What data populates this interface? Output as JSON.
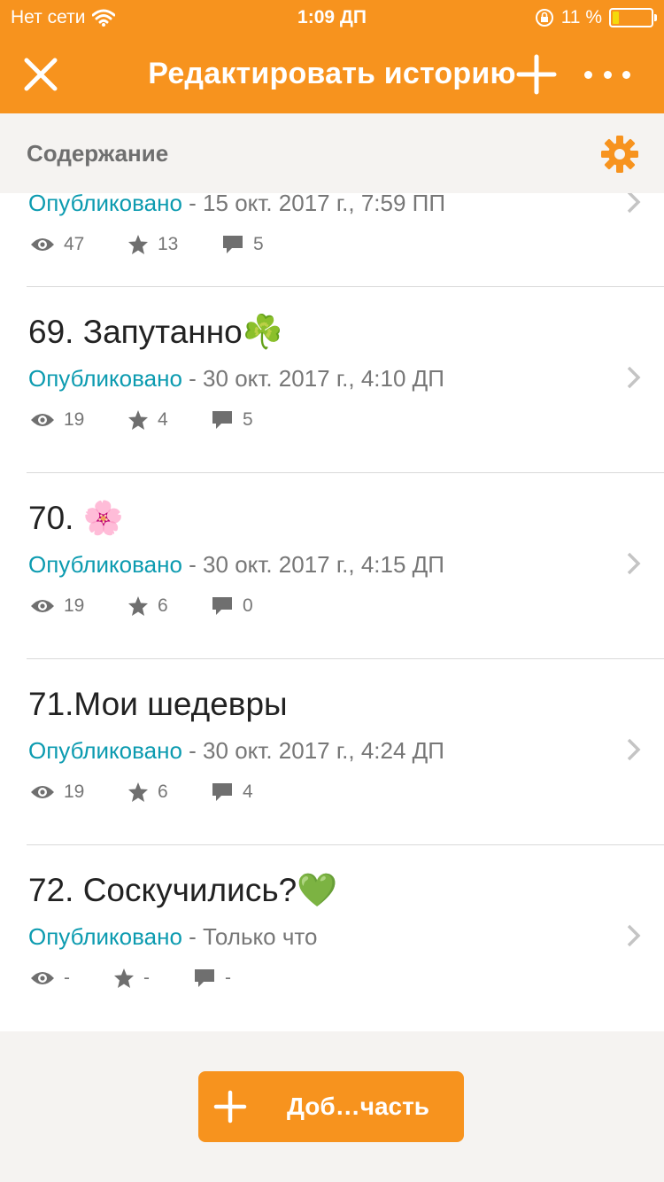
{
  "status_bar": {
    "carrier": "Нет сети",
    "time": "1:09 ДП",
    "battery": "11 %"
  },
  "nav": {
    "title": "Редактировать историю"
  },
  "contents": {
    "label": "Содержание"
  },
  "parts": [
    {
      "title": "",
      "status": "Опубликовано",
      "date": " - 15 окт. 2017 г., 7:59 ПП",
      "views": "47",
      "stars": "13",
      "comments": "5"
    },
    {
      "title": "69. Запутанно☘️",
      "status": "Опубликовано",
      "date": " - 30 окт. 2017 г., 4:10 ДП",
      "views": "19",
      "stars": "4",
      "comments": "5"
    },
    {
      "title": "70. 🌸",
      "status": "Опубликовано",
      "date": " - 30 окт. 2017 г., 4:15 ДП",
      "views": "19",
      "stars": "6",
      "comments": "0"
    },
    {
      "title": "71.Мои шедевры",
      "status": "Опубликовано",
      "date": " - 30 окт. 2017 г., 4:24 ДП",
      "views": "19",
      "stars": "6",
      "comments": "4"
    },
    {
      "title": "72. Соскучились?💚",
      "status": "Опубликовано",
      "date": " - Только что",
      "views": "-",
      "stars": "-",
      "comments": "-"
    }
  ],
  "add_button": {
    "label": "Доб…часть"
  },
  "colors": {
    "accent": "#f7931e",
    "published": "#0c9bb0"
  }
}
